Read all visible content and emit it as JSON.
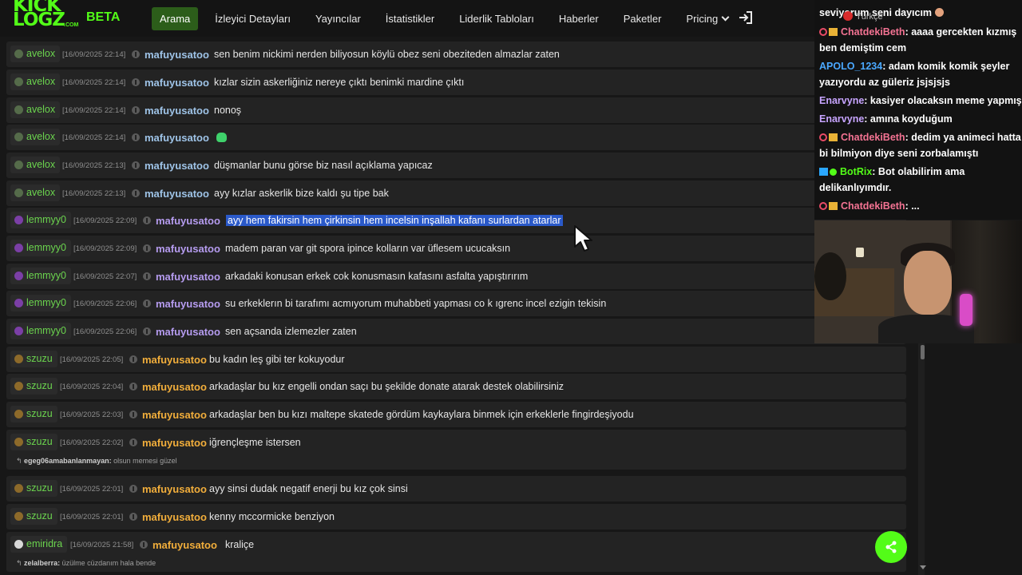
{
  "app": {
    "logo_line1": "KICK",
    "logo_line2": "LOGZ",
    "logo_suffix": ".COM",
    "beta_label": "BETA",
    "brand_color": "#53fc18"
  },
  "nav": {
    "items": [
      {
        "label": "Arama",
        "active": true
      },
      {
        "label": "İzleyici Detayları",
        "active": false
      },
      {
        "label": "Yayıncılar",
        "active": false
      },
      {
        "label": "İstatistikler",
        "active": false
      },
      {
        "label": "Liderlik Tabloları",
        "active": false
      },
      {
        "label": "Haberler",
        "active": false
      },
      {
        "label": "Paketler",
        "active": false
      },
      {
        "label": "Pricing",
        "active": false,
        "dropdown": true
      }
    ],
    "login_icon": "sign-in-icon"
  },
  "messages": [
    {
      "channel": "avelox",
      "time": "[16/09/2025 22:14]",
      "user": "mafuyusatoo",
      "text": "sen benim nickimi nerden biliyosun köylü obez seni obeziteden almazlar zaten"
    },
    {
      "channel": "avelox",
      "time": "[16/09/2025 22:14]",
      "user": "mafuyusatoo",
      "text": "kızlar sizin askerliğiniz nereye çıktı benimki mardine çıktı"
    },
    {
      "channel": "avelox",
      "time": "[16/09/2025 22:14]",
      "user": "mafuyusatoo",
      "text": "nonoş"
    },
    {
      "channel": "avelox",
      "time": "[16/09/2025 22:14]",
      "user": "mafuyusatoo",
      "text": "",
      "emote": "green-emote-icon"
    },
    {
      "channel": "avelox",
      "time": "[16/09/2025 22:13]",
      "user": "mafuyusatoo",
      "text": "düşmanlar bunu görse biz nasıl açıklama yapıcaz"
    },
    {
      "channel": "avelox",
      "time": "[16/09/2025 22:13]",
      "user": "mafuyusatoo",
      "text": "ayy kızlar askerlik bize kaldı şu tipe bak"
    },
    {
      "channel": "lemmyy0",
      "time": "[16/09/2025 22:09]",
      "user": "mafuyusatoo",
      "text": "ayy hem fakirsin hem çirkinsin hem incelsin inşallah kafanı surlardan atarlar",
      "selected": true
    },
    {
      "channel": "lemmyy0",
      "time": "[16/09/2025 22:09]",
      "user": "mafuyusatoo",
      "text": "madem paran var git spora ipince kolların var üflesem ucucaksın"
    },
    {
      "channel": "lemmyy0",
      "time": "[16/09/2025 22:07]",
      "user": "mafuyusatoo",
      "text": "arkadaki konusan erkek cok konusmasın kafasını asfalta yapıştırırım"
    },
    {
      "channel": "lemmyy0",
      "time": "[16/09/2025 22:06]",
      "user": "mafuyusatoo",
      "text": "su erkeklerın bi tarafımı acmıyorum muhabbeti yapması co k ıgrenc incel ezigin tekisin"
    },
    {
      "channel": "lemmyy0",
      "time": "[16/09/2025 22:06]",
      "user": "mafuyusatoo",
      "text": "sen açsanda izlemezler zaten"
    },
    {
      "channel": "szuzu",
      "time": "[16/09/2025 22:05]",
      "user": "mafuyusatoo",
      "text": "bu kadın leş gibi ter kokuyodur"
    },
    {
      "channel": "szuzu",
      "time": "[16/09/2025 22:04]",
      "user": "mafuyusatoo",
      "text": "arkadaşlar bu kız engelli ondan saçı bu şekilde donate atarak destek olabilirsiniz"
    },
    {
      "channel": "szuzu",
      "time": "[16/09/2025 22:03]",
      "user": "mafuyusatoo",
      "text": "arkadaşlar ben bu kızı maltepe skatede gördüm kaykaylara binmek için erkeklerle fingirdeşiyodu"
    },
    {
      "channel": "szuzu",
      "time": "[16/09/2025 22:02]",
      "user": "mafuyusatoo",
      "text": "iğrençleşme istersen",
      "reply_user": "egeg06amabanlanmayan:",
      "reply_text": "olsun memesi güzel"
    },
    {
      "channel": "szuzu",
      "time": "[16/09/2025 22:01]",
      "user": "mafuyusatoo",
      "text": "ayy sinsi dudak negatif enerji bu kız çok sinsi"
    },
    {
      "channel": "szuzu",
      "time": "[16/09/2025 22:01]",
      "user": "mafuyusatoo",
      "text": "kenny mccormicke benziyon"
    },
    {
      "channel": "emiridra",
      "time": "[16/09/2025 21:58]",
      "user": "mafuyusatoo",
      "text": "kraliçe",
      "reply_user": "zelalberra:",
      "reply_text": "üzülme cüzdanım hala bende"
    }
  ],
  "stream_chat": {
    "language": "Türkçe",
    "messages": [
      {
        "user": "",
        "text": "seviyorum seni dayıcım",
        "color": "#ffffff"
      },
      {
        "user": "ChatdekiBeth",
        "text": ": aaaa gercekten kızmış ben demiştim cem",
        "color": "#f47393",
        "badges": [
          "mod",
          "sub"
        ]
      },
      {
        "user": "APOLO_1234",
        "text": ": adam komik komik şeyler yazıyordu az güleriz jsjsjsjs",
        "color": "#4aa8ff",
        "badges": []
      },
      {
        "user": "Enarvyne",
        "text": ": kasiyer olacaksın meme yapmış",
        "color": "#c7a4ff",
        "badges": []
      },
      {
        "user": "Enarvyne",
        "text": ": amına koyduğum",
        "color": "#c7a4ff",
        "badges": []
      },
      {
        "user": "ChatdekiBeth",
        "text": ": dedim ya animeci hatta bi bilmiyon diye seni zorbalamıştı",
        "color": "#f47393",
        "badges": [
          "mod",
          "sub"
        ]
      },
      {
        "user": "BotRix",
        "text": ": Bot olabilirim ama delikanlıyımdır.",
        "color": "#53fc18",
        "badges": [
          "bot",
          "verified"
        ]
      },
      {
        "user": "ChatdekiBeth",
        "text": ": ...",
        "color": "#f47393",
        "badges": [
          "mod",
          "sub"
        ]
      }
    ]
  },
  "share_icon": "share-icon"
}
